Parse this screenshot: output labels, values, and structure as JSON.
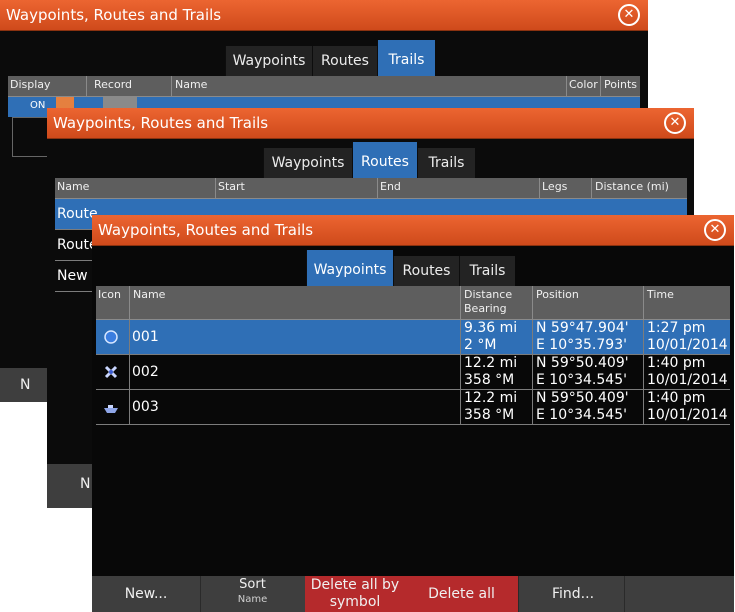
{
  "window_back": {
    "title": "Waypoints, Routes and Trails",
    "tabs": [
      "Waypoints",
      "Routes",
      "Trails"
    ],
    "active_tab": "Trails",
    "columns": {
      "display": "Display",
      "record": "Record",
      "name": "Name",
      "color": "Color",
      "points": "Points"
    },
    "row1": {
      "display": "ON"
    },
    "bottom_button": "N"
  },
  "window_mid": {
    "title": "Waypoints, Routes and Trails",
    "tabs": [
      "Waypoints",
      "Routes",
      "Trails"
    ],
    "active_tab": "Routes",
    "columns": {
      "name": "Name",
      "start": "Start",
      "end": "End",
      "legs": "Legs",
      "distance": "Distance (mi)"
    },
    "rows": [
      {
        "name": "Route"
      },
      {
        "name": "Route"
      },
      {
        "name": "New"
      }
    ],
    "bottom_button": "N"
  },
  "window_front": {
    "title": "Waypoints, Routes and Trails",
    "tabs": [
      "Waypoints",
      "Routes",
      "Trails"
    ],
    "active_tab": "Waypoints",
    "columns": {
      "icon": "Icon",
      "name": "Name",
      "distance": "Distance",
      "bearing": "Bearing",
      "position": "Position",
      "time": "Time"
    },
    "waypoints": [
      {
        "icon": "blue-circle-icon",
        "name": "001",
        "distance": "9.36 mi",
        "bearing": "2 °M",
        "lat": "N  59°47.904'",
        "lon": "E  10°35.793'",
        "time": "1:27 pm",
        "date": "10/01/2014"
      },
      {
        "icon": "cross-marker-icon",
        "name": "002",
        "distance": "12.2 mi",
        "bearing": "358 °M",
        "lat": "N  59°50.409'",
        "lon": "E  10°34.545'",
        "time": "1:40 pm",
        "date": "10/01/2014"
      },
      {
        "icon": "boat-icon",
        "name": "003",
        "distance": "12.2 mi",
        "bearing": "358 °M",
        "lat": "N  59°50.409'",
        "lon": "E  10°34.545'",
        "time": "1:40 pm",
        "date": "10/01/2014"
      }
    ],
    "bottom": {
      "new": "New...",
      "sort": "Sort",
      "sort_by": "Name",
      "delete_by_symbol_1": "Delete all by",
      "delete_by_symbol_2": "symbol",
      "delete_all": "Delete all",
      "find": "Find..."
    }
  },
  "colors": {
    "title_bar": "#e05a26",
    "selection": "#2f6fb6",
    "delete_button": "#b52a2c"
  }
}
